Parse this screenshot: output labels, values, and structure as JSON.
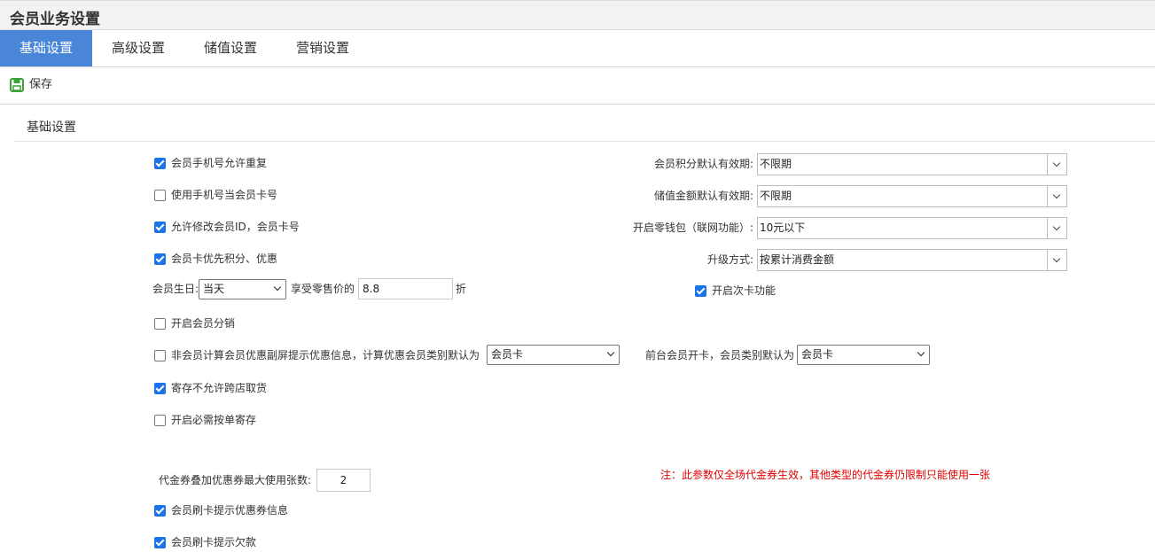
{
  "header": {
    "title": "会员业务设置"
  },
  "tabs": [
    {
      "label": "基础设置"
    },
    {
      "label": "高级设置"
    },
    {
      "label": "储值设置"
    },
    {
      "label": "营销设置"
    }
  ],
  "toolbar": {
    "save_label": "保存"
  },
  "section": {
    "title": "基础设置"
  },
  "checkboxes": [
    {
      "label": "会员手机号允许重复",
      "checked": true
    },
    {
      "label": "使用手机号当会员卡号",
      "checked": false
    },
    {
      "label": "允许修改会员ID，会员卡号",
      "checked": true
    },
    {
      "label": "会员卡优先积分、优惠",
      "checked": true
    },
    {
      "label": "开启会员分销",
      "checked": false
    },
    {
      "label": "非会员计算会员优惠副屏提示优惠信息，计算优惠会员类别默认为",
      "checked": false
    },
    {
      "label": "寄存不允许跨店取货",
      "checked": true
    },
    {
      "label": "开启必需按单寄存",
      "checked": false
    },
    {
      "label": "会员刷卡提示优惠券信息",
      "checked": true
    },
    {
      "label": "会员刷卡提示欠款",
      "checked": true
    },
    {
      "label": "开启次卡功能",
      "checked": true
    }
  ],
  "birthday": {
    "label": "会员生日:",
    "select_value": "当天",
    "middle_label": "享受零售价的",
    "discount": "8.8",
    "unit": "折"
  },
  "nonmember_select": {
    "value": "会员卡"
  },
  "front_desk": {
    "label": "前台会员开卡，会员类别默认为",
    "value": "会员卡"
  },
  "right_settings": [
    {
      "label": "会员积分默认有效期:",
      "value": "不限期"
    },
    {
      "label": "储值金额默认有效期:",
      "value": "不限期"
    },
    {
      "label": "开启零钱包（联网功能）:",
      "value": "10元以下"
    },
    {
      "label": "升级方式:",
      "value": "按累计消费金额"
    }
  ],
  "coupon": {
    "label": "代金券叠加优惠券最大使用张数:",
    "value": "2"
  },
  "note": "注：此参数仅全场代金券生效，其他类型的代金券仍限制只能使用一张"
}
